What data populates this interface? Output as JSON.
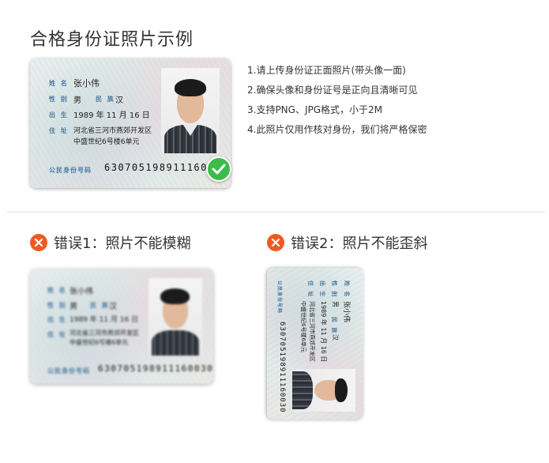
{
  "page": {
    "title": "合格身份证照片示例"
  },
  "sample_card": {
    "name_label": "姓 名",
    "name": "张小伟",
    "sex_label": "性 别",
    "sex": "男",
    "ethnic_label": "民 族",
    "ethnic": "汉",
    "birth_label": "出 生",
    "birth": "1989 年 11 月 16 日",
    "address_label": "住 址",
    "address_line1": "河北省三河市燕郊开发区",
    "address_line2": "中盛世纪6号楼6单元",
    "id_label": "公民身份号码",
    "id_number": "630705198911160030"
  },
  "rules": [
    "1.请上传身份证正面照片(带头像一面)",
    "2.确保头像和身份证号是正向且清晰可见",
    "3.支持PNG、JPG格式，小于2M",
    "4.此照片仅用作核对身份，我们将严格保密"
  ],
  "errors": [
    {
      "label": "错误1：照片不能模糊"
    },
    {
      "label": "错误2：照片不能歪斜"
    }
  ],
  "colors": {
    "check": "#3dbb4a",
    "error": "#ef5a22",
    "label_blue": "#4a7aa3"
  }
}
